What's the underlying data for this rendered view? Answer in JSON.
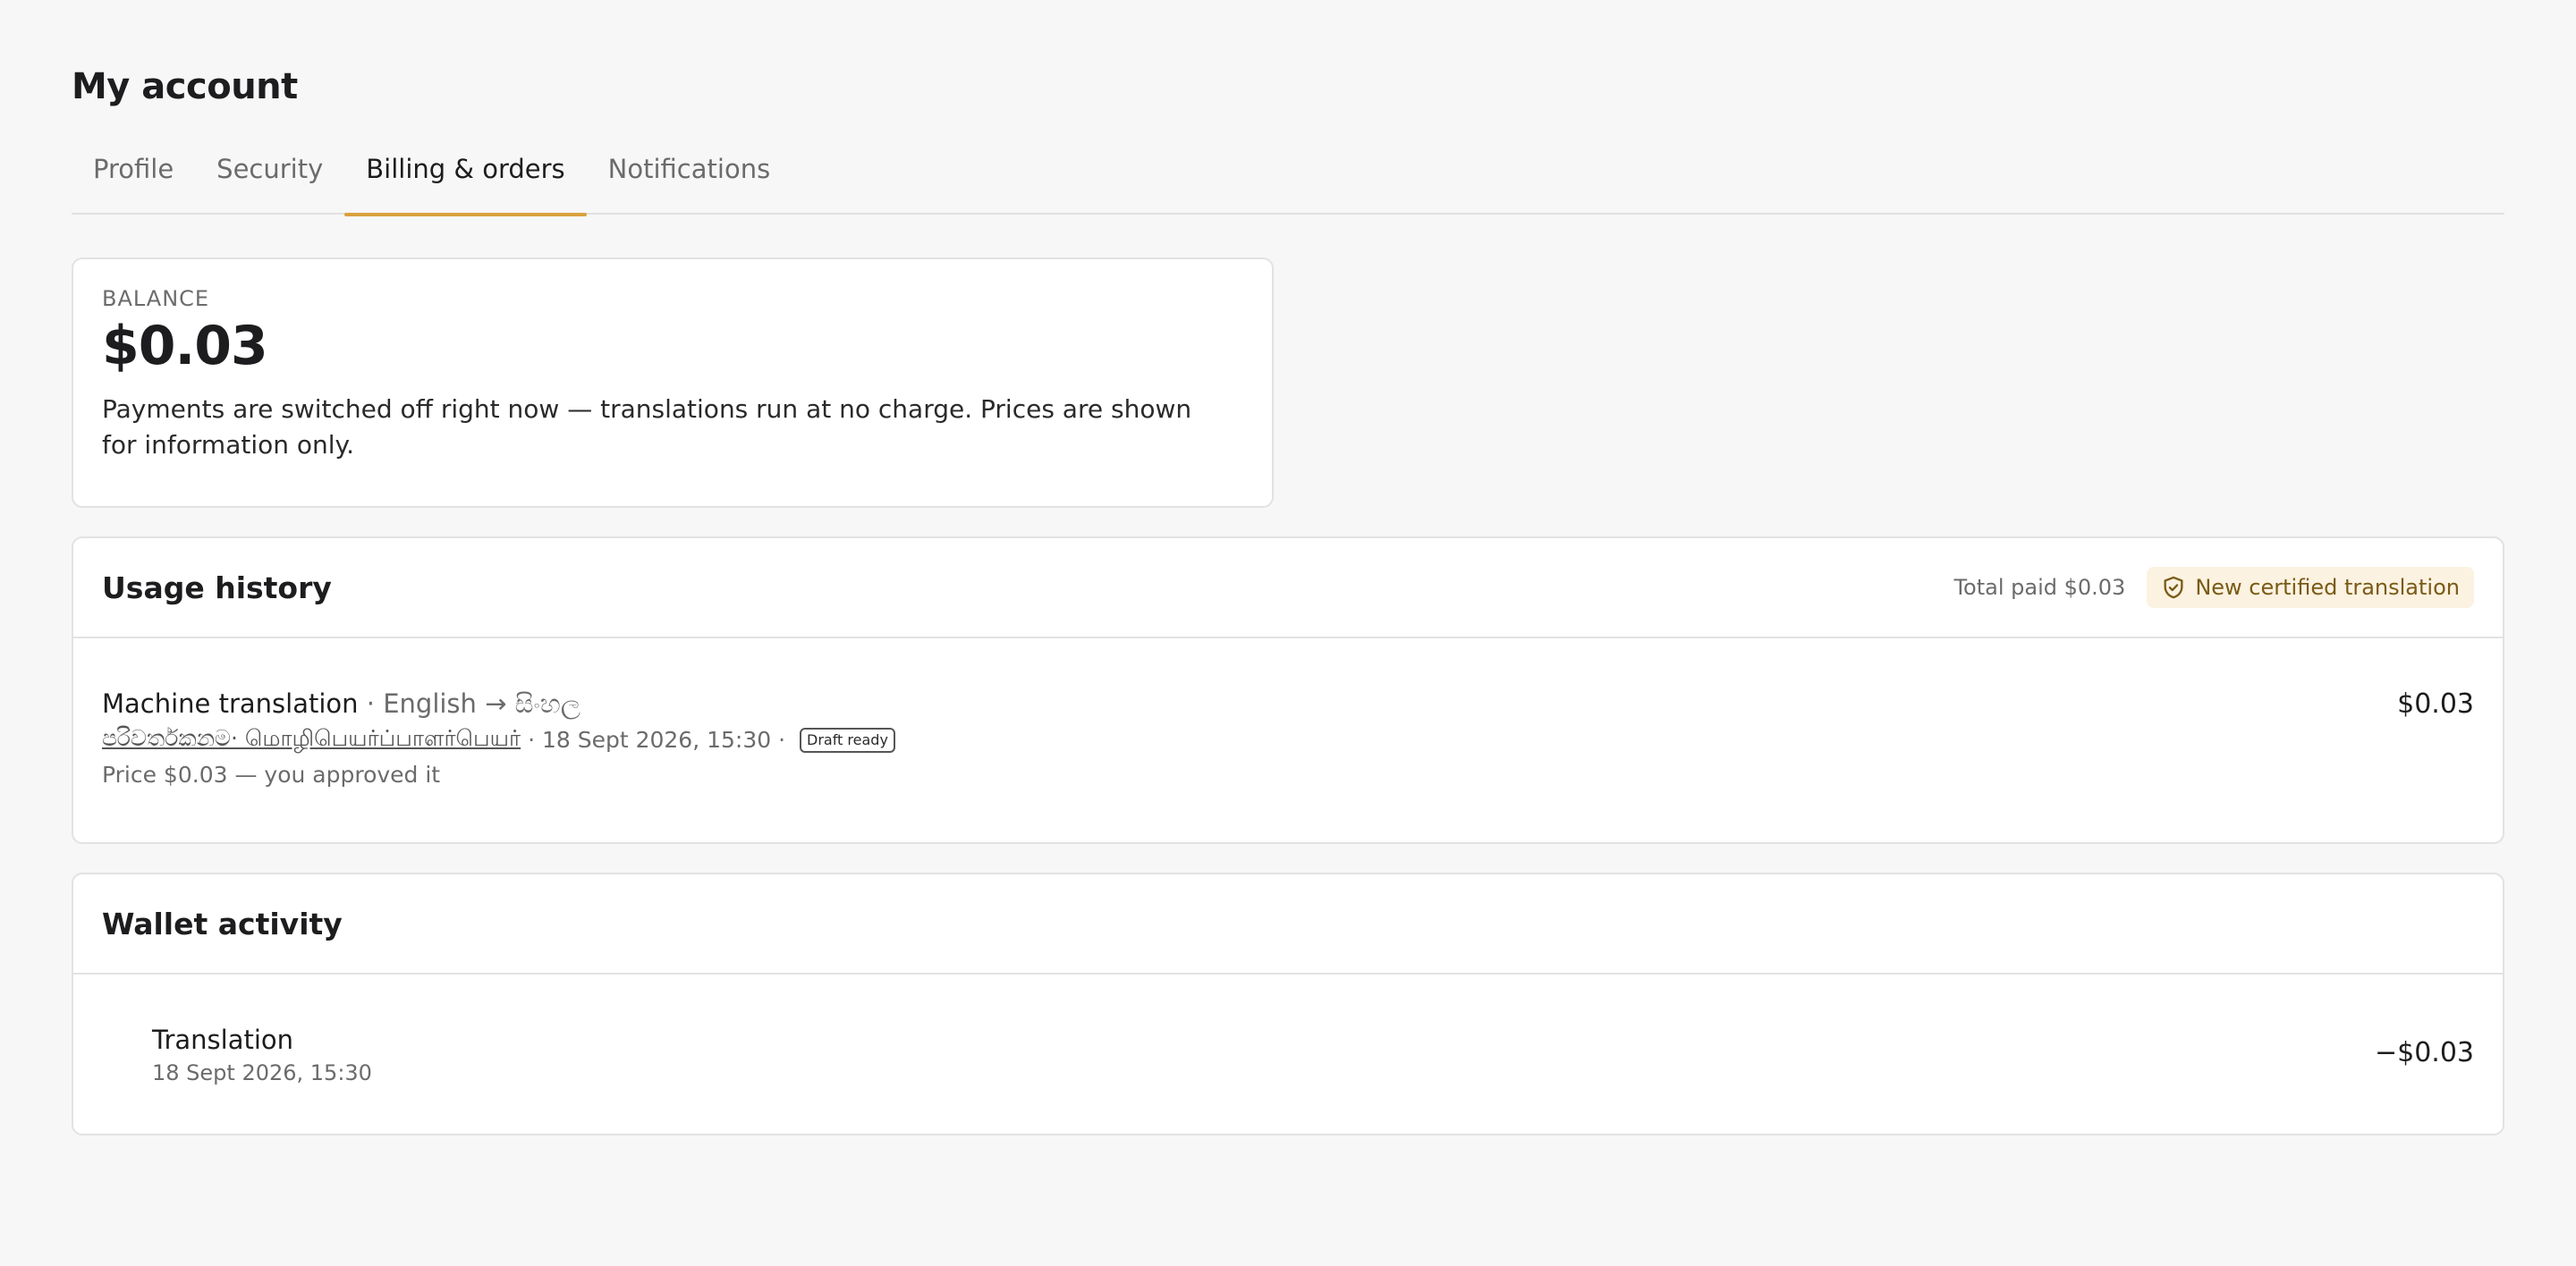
{
  "page": {
    "title": "My account"
  },
  "tabs": [
    {
      "label": "Profile"
    },
    {
      "label": "Security"
    },
    {
      "label": "Billing & orders"
    },
    {
      "label": "Notifications"
    }
  ],
  "balance": {
    "label": "BALANCE",
    "amount": "$0.03",
    "note": "Payments are switched off right now — translations run at no charge. Prices are shown for information only."
  },
  "usage": {
    "title": "Usage history",
    "total_paid": "Total paid $0.03",
    "cert_button": "New certified translation",
    "cert_icon": "shield-check-icon",
    "items": [
      {
        "service": "Machine translation",
        "languages": " · English → සිංහල",
        "doc_name": "පරිවර්තකනම· மொழிபெயர்ப்பாளர்பெயர்",
        "datetime": " · 18 Sept 2026, 15:30 · ",
        "status": "Draft ready",
        "price_note": "Price $0.03 — you approved it",
        "amount": "$0.03"
      }
    ]
  },
  "wallet": {
    "title": "Wallet activity",
    "items": [
      {
        "title": "Translation",
        "date": "18 Sept 2026, 15:30",
        "amount": "−$0.03"
      }
    ]
  },
  "colors": {
    "accent": "#d9a13b",
    "badge_bg": "#fbf2e1",
    "badge_text": "#7a5a15"
  }
}
